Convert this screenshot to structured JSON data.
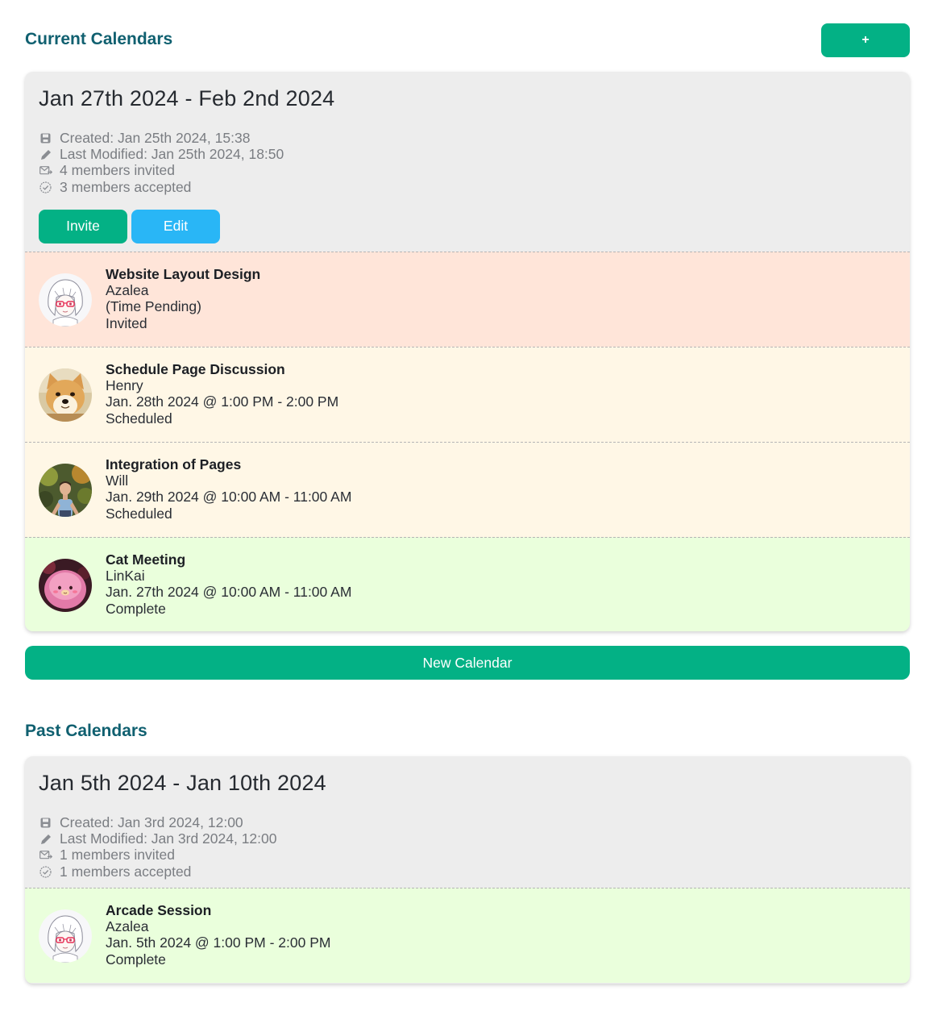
{
  "current_section": {
    "title": "Current Calendars",
    "add_button_label": "+",
    "new_calendar_label": "New Calendar",
    "calendar": {
      "range": "Jan 27th 2024 - Feb 2nd 2024",
      "created": "Created: Jan 25th 2024, 15:38",
      "modified": "Last Modified: Jan 25th 2024, 18:50",
      "invited": "4 members invited",
      "accepted": "3 members accepted",
      "invite_label": "Invite",
      "edit_label": "Edit",
      "events": [
        {
          "title": "Website Layout Design",
          "person": "Azalea",
          "time": "(Time Pending)",
          "status": "Invited",
          "avatar": "anime-girl-avatar",
          "state_color": "#ffe5d9"
        },
        {
          "title": "Schedule Page Discussion",
          "person": "Henry",
          "time": "Jan. 28th 2024 @ 1:00 PM - 2:00 PM",
          "status": "Scheduled",
          "avatar": "shiba-dog-avatar",
          "state_color": "#fff7e6"
        },
        {
          "title": "Integration of Pages",
          "person": "Will",
          "time": "Jan. 29th 2024 @ 10:00 AM - 11:00 AM",
          "status": "Scheduled",
          "avatar": "man-outdoors-avatar",
          "state_color": "#fff7e6"
        },
        {
          "title": "Cat Meeting",
          "person": "LinKai",
          "time": "Jan. 27th 2024 @ 10:00 AM - 11:00 AM",
          "status": "Complete",
          "avatar": "pink-plush-avatar",
          "state_color": "#eaffdc"
        }
      ]
    }
  },
  "past_section": {
    "title": "Past Calendars",
    "calendar": {
      "range": "Jan 5th 2024 - Jan 10th 2024",
      "created": "Created: Jan 3rd 2024, 12:00",
      "modified": "Last Modified: Jan 3rd 2024, 12:00",
      "invited": "1 members invited",
      "accepted": "1 members accepted",
      "events": [
        {
          "title": "Arcade Session",
          "person": "Azalea",
          "time": "Jan. 5th 2024 @ 1:00 PM - 2:00 PM",
          "status": "Complete",
          "avatar": "anime-girl-avatar",
          "state_color": "#eaffdc"
        }
      ]
    }
  },
  "colors": {
    "accent_green": "#03b185",
    "accent_blue": "#29b6f6",
    "heading_teal": "#106070",
    "card_bg": "#ededed"
  }
}
